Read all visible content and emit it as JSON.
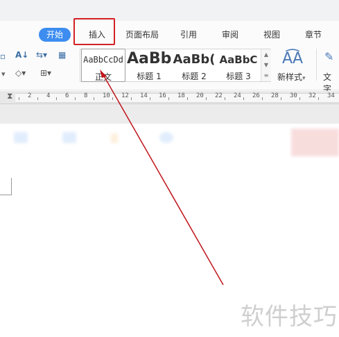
{
  "tabs": [
    {
      "label": "开始",
      "active": true
    },
    {
      "label": "插入",
      "highlighted": true
    },
    {
      "label": "页面布局"
    },
    {
      "label": "引用"
    },
    {
      "label": "审阅"
    },
    {
      "label": "视图"
    },
    {
      "label": "章节"
    }
  ],
  "styles": [
    {
      "sample": "AaBbCcDd",
      "label": "正文"
    },
    {
      "sample": "AaBb",
      "label": "标题 1"
    },
    {
      "sample": "AaBb(",
      "label": "标题 2"
    },
    {
      "sample": "AaBbC",
      "label": "标题 3"
    }
  ],
  "new_style_label": "新样式",
  "text_tool_label": "文字",
  "ruler_numbers": [
    "2",
    "4",
    "6",
    "8",
    "10",
    "12",
    "14",
    "16",
    "18",
    "20",
    "22",
    "24",
    "26",
    "28",
    "30",
    "32",
    "34"
  ],
  "watermark": "软件技巧",
  "colors": {
    "accent": "#3d8df0",
    "highlight_box": "#d42025",
    "arrow": "#c0151b"
  }
}
